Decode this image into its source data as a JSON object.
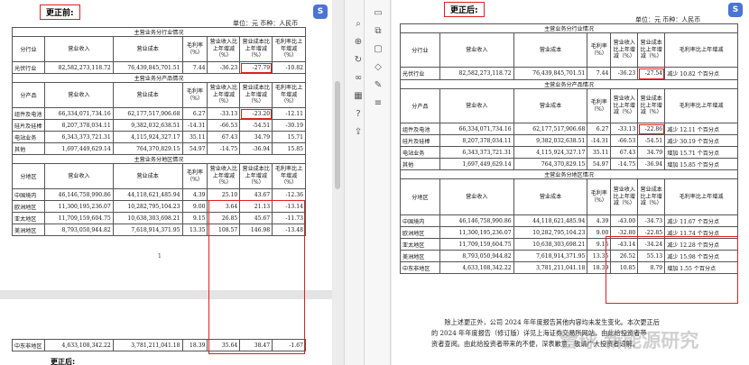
{
  "before": {
    "label": "更正前:",
    "unit": "单位：元 币种：人民币",
    "headers": [
      "营业收入",
      "营业成本",
      "毛利率（%）",
      "营业收入比上年增减（%）",
      "营业成本比上年增减（%）",
      "毛利率比上年增减（%）"
    ],
    "industry": {
      "title": "主营业务分行业情况",
      "col0": "分行业",
      "rows": [
        [
          "光伏行业",
          "82,582,273,118.72",
          "76,439,845,701.51",
          "7.44",
          "-36.23",
          "-27.79",
          "-10.82"
        ]
      ]
    },
    "product": {
      "title": "主营业务分产品情况",
      "col0": "分产品",
      "rows": [
        [
          "组件及电池",
          "66,334,071,734.16",
          "62,177,517,906.68",
          "6.27",
          "-33.13",
          "-23.20",
          "-12.11"
        ],
        [
          "硅片及硅棒",
          "8,207,378,034.11",
          "9,382,032,638.51",
          "-14.31",
          "-66.53",
          "-54.51",
          "-30.19"
        ],
        [
          "电站业务",
          "6,343,373,721.31",
          "4,115,924,327.17",
          "35.11",
          "67.43",
          "34.79",
          "15.71"
        ],
        [
          "其他",
          "1,697,449,629.14",
          "764,370,829.15",
          "54.97",
          "-14.75",
          "-36.94",
          "15.85"
        ]
      ]
    },
    "region": {
      "title": "主营业务分地区情况",
      "col0": "分地区",
      "rows": [
        [
          "中国境内",
          "46,146,758,990.86",
          "44,118,621,485.94",
          "4.39",
          "25.10",
          "43.67",
          "-12.36"
        ],
        [
          "欧洲地区",
          "11,300,195,236.07",
          "10,282,795,104.23",
          "9.00",
          "3.64",
          "21.13",
          "-13.14"
        ],
        [
          "亚太地区",
          "11,709,159,604.75",
          "10,638,303,698.21",
          "9.15",
          "26.85",
          "45.67",
          "-11.73"
        ],
        [
          "美洲地区",
          "8,793,050,944.82",
          "7,618,914,371.95",
          "13.35",
          "108.57",
          "146.98",
          "-13.48"
        ]
      ],
      "continued_row": [
        "中东非地区",
        "4,633,108,342.22",
        "3,781,211,041.18",
        "18.39",
        "35.64",
        "38.47",
        "-1.67"
      ]
    },
    "page_number": "1",
    "next_label": "更正后:"
  },
  "after": {
    "label": "更正后:",
    "unit": "单位：元 币种：人民币",
    "headers": [
      "营业收入",
      "营业成本",
      "毛利率（%）",
      "营业收入比上年增减（%）",
      "营业成本比上年增减（%）",
      "毛利率比上年增减"
    ],
    "industry": {
      "title": "主营业务分行业情况",
      "col0": "分行业",
      "rows": [
        [
          "光伏行业",
          "82,582,273,118.72",
          "76,439,845,701.51",
          "7.44",
          "-36.23",
          "-27.54",
          "减少 10.82 个百分点"
        ]
      ]
    },
    "product": {
      "title": "主营业务分产品情况",
      "col0": "分产品",
      "rows": [
        [
          "组件及电池",
          "66,334,071,734.16",
          "62,177,517,906.68",
          "6.27",
          "-33.13",
          "-22.86",
          "减少 12.11 个百分点"
        ],
        [
          "硅片及硅棒",
          "8,207,378,034.11",
          "9,382,032,638.51",
          "-14.31",
          "-66.53",
          "-54.51",
          "减少 30.19 个百分点"
        ],
        [
          "电站业务",
          "6,343,373,721.31",
          "4,115,924,327.17",
          "35.11",
          "67.43",
          "34.79",
          "增加 15.71 个百分点"
        ],
        [
          "其他",
          "1,697,449,629.14",
          "764,370,829.15",
          "54.97",
          "-14.75",
          "-36.94",
          "增加 15.85 个百分点"
        ]
      ]
    },
    "region": {
      "title": "主营业务分地区情况",
      "col0": "分地区",
      "rows": [
        [
          "中国境内",
          "46,146,758,990.86",
          "44,118,621,485.94",
          "4.39",
          "-43.00",
          "-34.73",
          "减少 11.67 个百分点"
        ],
        [
          "欧洲地区",
          "11,300,195,236.07",
          "10,282,795,104.23",
          "9.00",
          "-32.80",
          "-22.85",
          "减少 11.74 个百分点"
        ],
        [
          "亚太地区",
          "11,709,159,604.75",
          "10,638,303,698.21",
          "9.15",
          "-43.14",
          "-34.24",
          "减少 12.28 个百分点"
        ],
        [
          "美洲地区",
          "8,793,050,944.82",
          "7,618,914,371.95",
          "13.35",
          "26.52",
          "55.13",
          "减少 15.98 个百分点"
        ],
        [
          "中东非地区",
          "4,633,108,342.22",
          "3,781,211,041.18",
          "18.39",
          "10.85",
          "8.79",
          "增加 1.55 个百分点"
        ]
      ]
    },
    "paragraph": [
      "除上述更正外，公司 2024 年年度报告其他内容均未发生变化。本次更正后",
      "的 2024 年年度报告（修订版）详见上海证券交易所网站，由此给投资者带",
      "资者查阅。由此给投资者带来的不便，深表歉意，敬请广大投资者谅解。"
    ],
    "watermark": "雪球 新能源研究"
  },
  "toolbar": {
    "avatar": "S",
    "icons": [
      "search-icon",
      "zoom-icon",
      "rotate-icon",
      "link-icon",
      "layout-icon",
      "help-icon",
      "export-icon"
    ],
    "right_icons": [
      "bookmark-icon",
      "copy-icon",
      "comment-icon",
      "tag-icon",
      "pen-icon",
      "layers-icon"
    ]
  }
}
